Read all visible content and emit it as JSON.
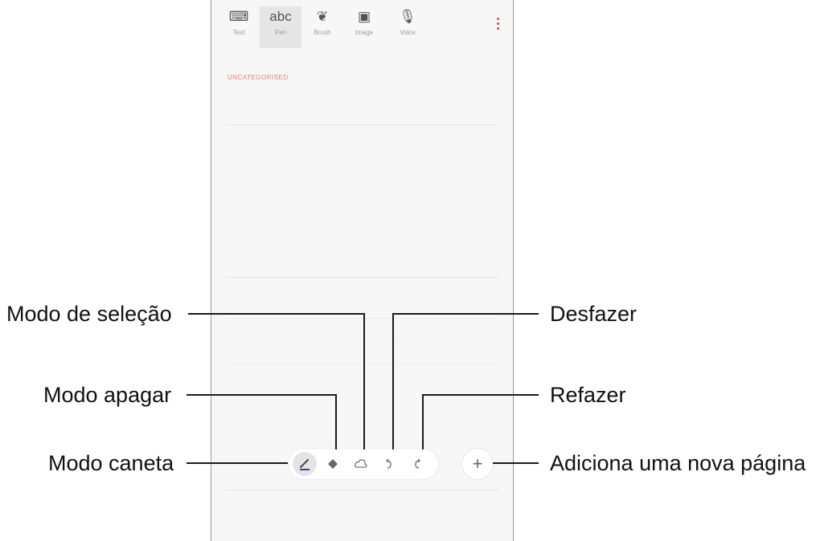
{
  "toolbar": {
    "tools": [
      {
        "glyph": "⌨",
        "label": "Text",
        "icon": "keyboard-icon"
      },
      {
        "glyph": "abc",
        "label": "Pen",
        "icon": "handwriting-icon"
      },
      {
        "glyph": "❦",
        "label": "Brush",
        "icon": "brush-icon"
      },
      {
        "glyph": "▣",
        "label": "Image",
        "icon": "image-icon"
      },
      {
        "glyph": "🎙",
        "label": "Voice",
        "icon": "microphone-icon"
      }
    ],
    "active_tool": "Pen"
  },
  "note": {
    "category": "UNCATEGORISED"
  },
  "pen_toolbar": {
    "pen_icon": "pen-icon",
    "eraser_icon": "eraser-icon",
    "selection_icon": "lasso-selection-icon",
    "undo_icon": "undo-icon",
    "redo_icon": "redo-icon",
    "add_page_glyph": "+"
  },
  "callouts": {
    "selection_mode": "Modo de seleção",
    "eraser_mode": "Modo apagar",
    "pen_mode": "Modo caneta",
    "undo": "Desfazer",
    "redo": "Refazer",
    "add_page": "Adiciona uma nova página"
  },
  "colors": {
    "accent": "#e0484e",
    "pen_stroke": "#3b3fa8",
    "callout_line": "#1a1a1a"
  }
}
